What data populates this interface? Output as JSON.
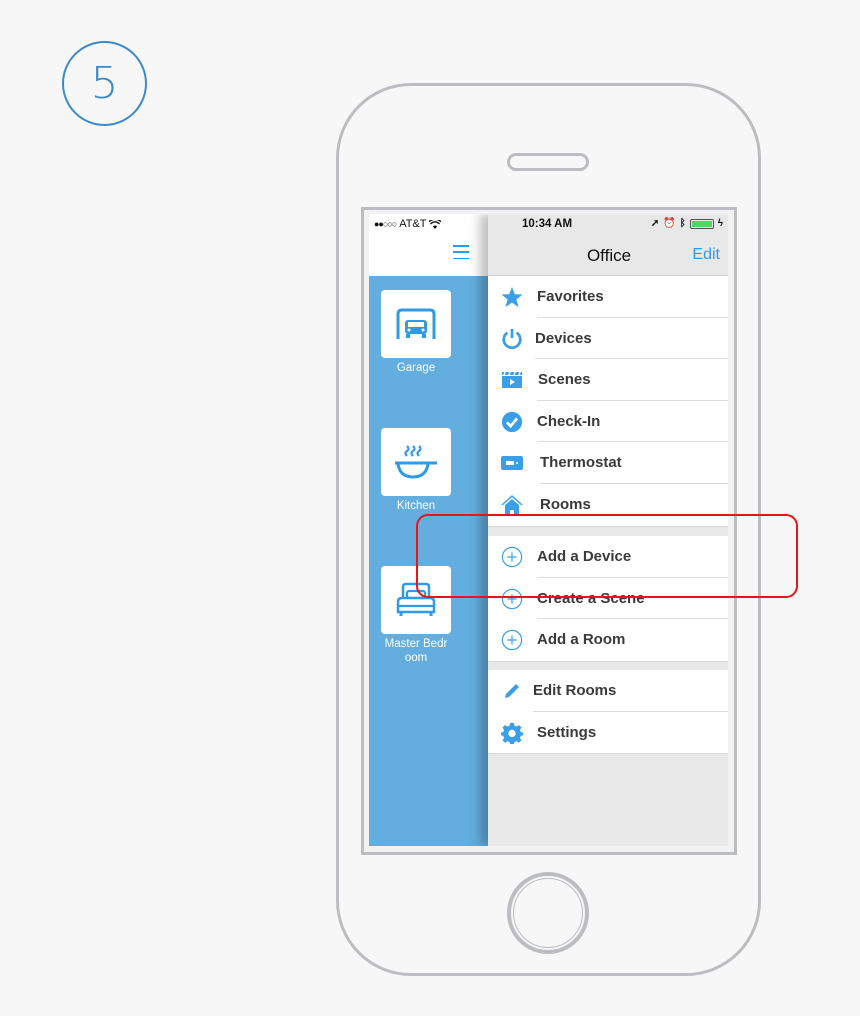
{
  "step_badge": "5",
  "status_bar": {
    "signal": "●●○○○",
    "carrier": "AT&T",
    "time": "10:34 AM",
    "battery_percent": 100
  },
  "drawer": {
    "rooms": [
      {
        "label": "Garage",
        "icon": "garage-car-icon"
      },
      {
        "label": "Kitchen",
        "icon": "pan-icon"
      },
      {
        "label": "Master Bedr\noom",
        "icon": "bed-icon"
      }
    ]
  },
  "nav": {
    "title": "Office",
    "edit_label": "Edit"
  },
  "menu": {
    "section1": [
      {
        "label": "Favorites",
        "icon": "star-icon"
      },
      {
        "label": "Devices",
        "icon": "power-icon"
      },
      {
        "label": "Scenes",
        "icon": "clapperboard-icon"
      },
      {
        "label": "Check-In",
        "icon": "check-circle-icon"
      },
      {
        "label": "Thermostat",
        "icon": "thermostat-icon"
      },
      {
        "label": "Rooms",
        "icon": "house-icon"
      }
    ],
    "section2": [
      {
        "label": "Add a Device",
        "icon": "plus-circle-icon"
      },
      {
        "label": "Create a Scene",
        "icon": "plus-circle-icon"
      },
      {
        "label": "Add a Room",
        "icon": "plus-circle-icon"
      }
    ],
    "section3": [
      {
        "label": "Edit Rooms",
        "icon": "pencil-icon"
      },
      {
        "label": "Settings",
        "icon": "gear-icon"
      }
    ]
  },
  "colors": {
    "accent": "#2f9be7",
    "drawer_bg": "#63aedf",
    "highlight": "#e8141c",
    "badge": "#3d8ac8"
  }
}
